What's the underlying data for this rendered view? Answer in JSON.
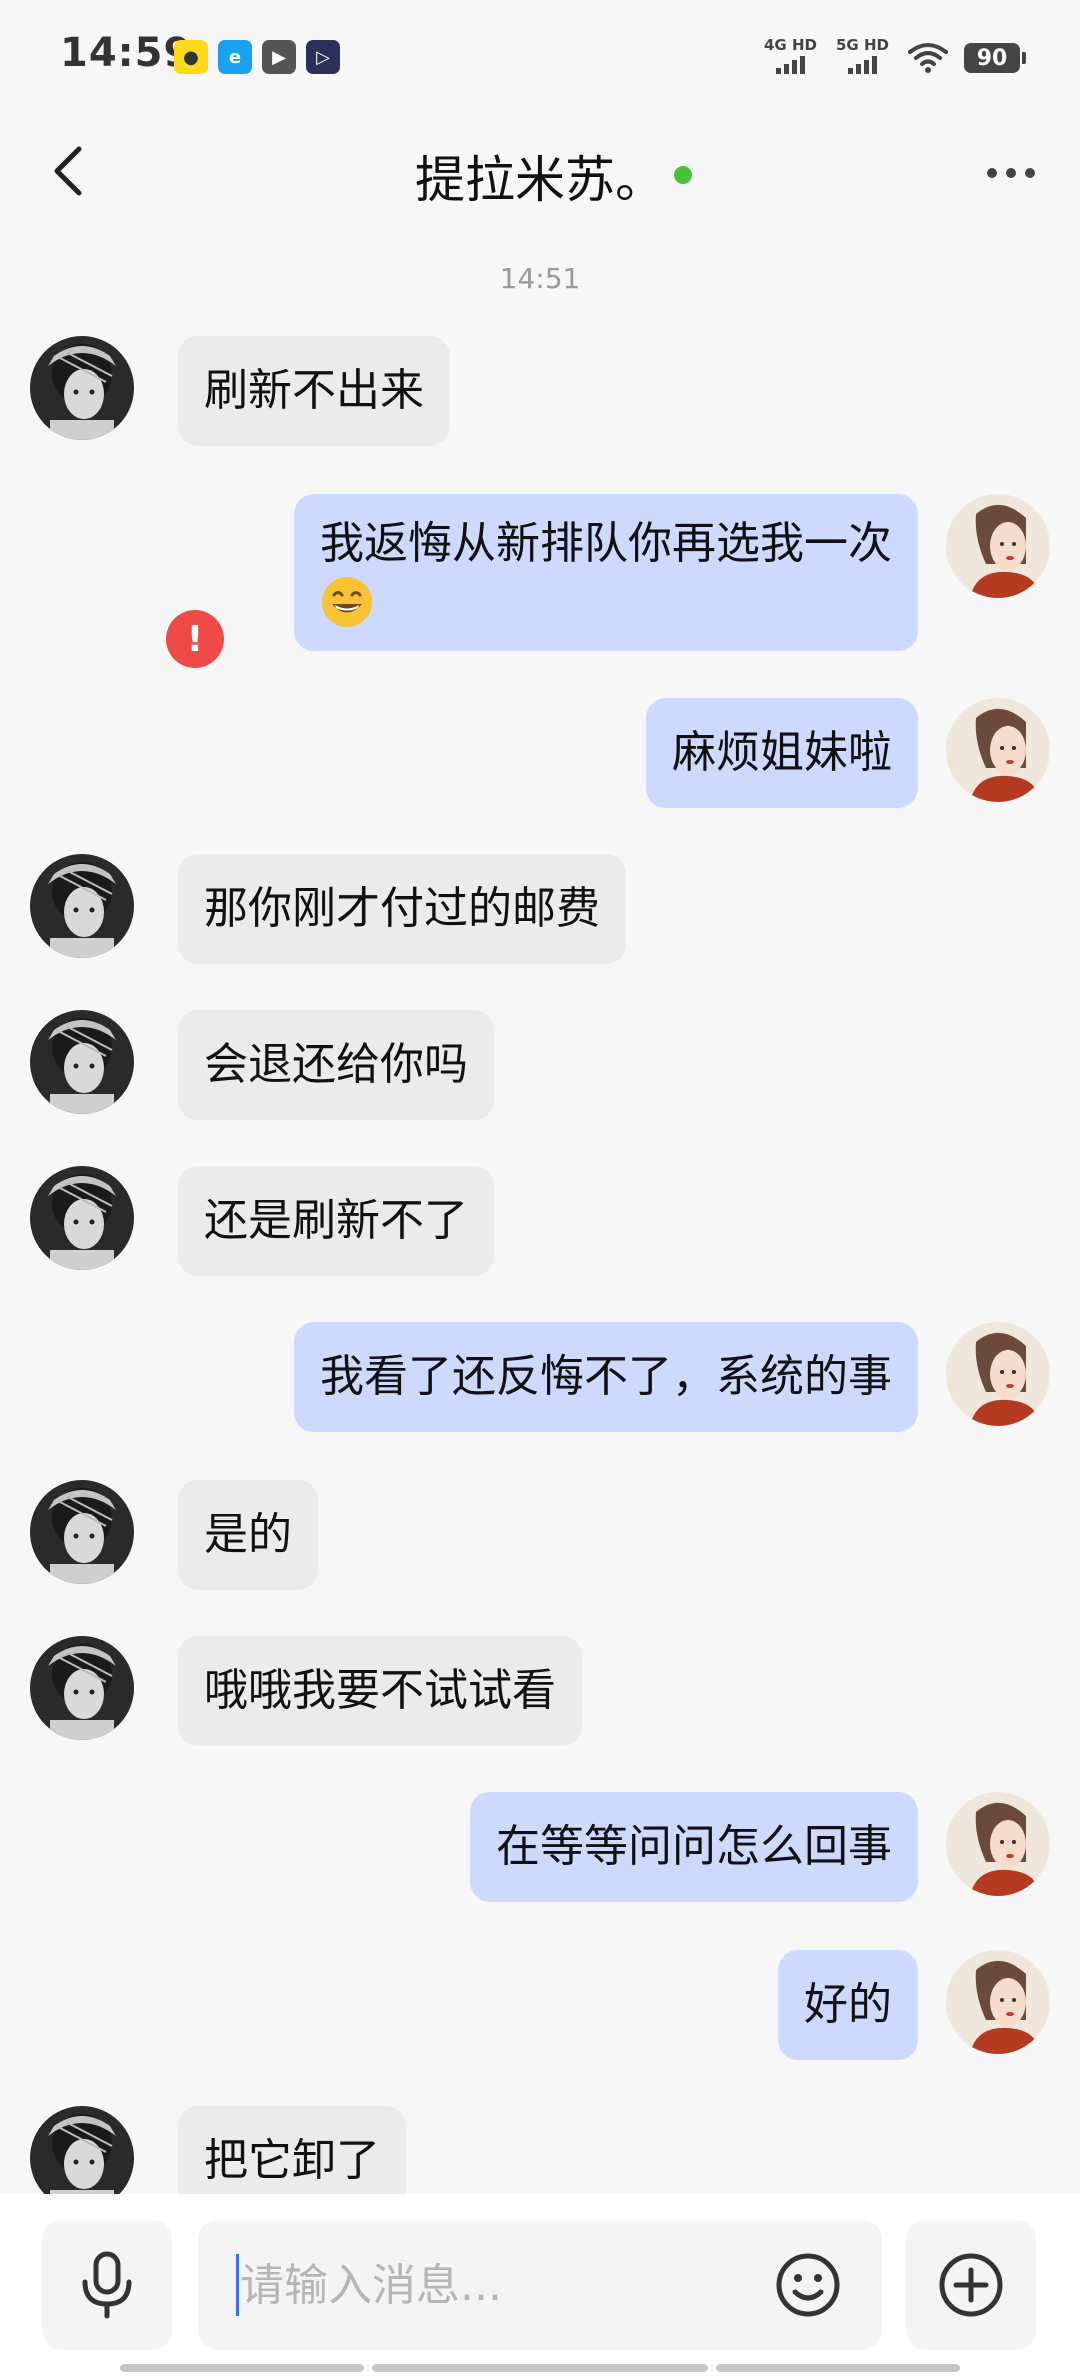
{
  "status_bar": {
    "time": "14:59",
    "network_1": "4G HD",
    "network_2": "5G HD",
    "battery": "90",
    "app_icons": [
      "yellow-app-icon",
      "blue-app-icon",
      "play-app-icon",
      "video-app-icon"
    ]
  },
  "header": {
    "title": "提拉米苏。",
    "status": "online",
    "online_color": "#48c23d"
  },
  "chat": {
    "timestamp": "14:51",
    "messages": [
      {
        "side": "in",
        "text": "刷新不出来"
      },
      {
        "side": "out",
        "text": "我返悔从新排队你再选我一次",
        "emoji": "grinning-face",
        "failed": true,
        "fail_mark": "!"
      },
      {
        "side": "out",
        "text": "麻烦姐妹啦"
      },
      {
        "side": "in",
        "text": "那你刚才付过的邮费"
      },
      {
        "side": "in",
        "text": "会退还给你吗"
      },
      {
        "side": "in",
        "text": "还是刷新不了"
      },
      {
        "side": "out",
        "text": "我看了还反悔不了，系统的事"
      },
      {
        "side": "in",
        "text": "是的"
      },
      {
        "side": "in",
        "text": "哦哦我要不试试看"
      },
      {
        "side": "out",
        "text": "在等等问问怎么回事"
      },
      {
        "side": "out",
        "text": "好的"
      },
      {
        "side": "in",
        "text": "把它卸了"
      }
    ]
  },
  "input_bar": {
    "placeholder": "请输入消息...",
    "value": ""
  },
  "colors": {
    "incoming_bubble": "#ebebeb",
    "outgoing_bubble": "#cdd9ff",
    "fail_badge": "#ee4a48"
  }
}
